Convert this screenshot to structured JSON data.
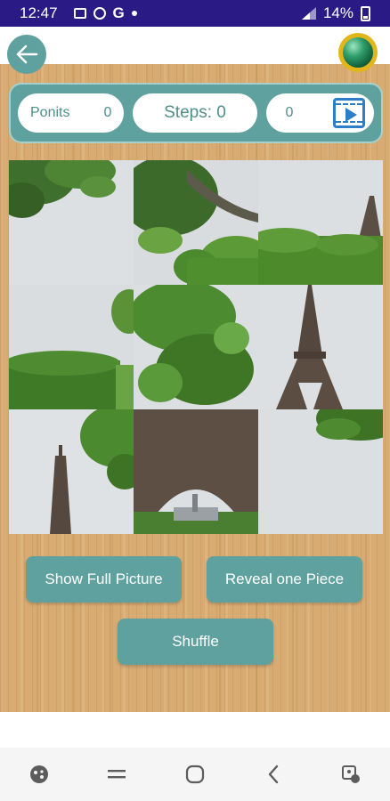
{
  "status": {
    "time": "12:47",
    "notification_icons": [
      "image-icon",
      "whatsapp-icon",
      "google-icon",
      "dot-icon"
    ],
    "google_letter": "G",
    "battery": "14%"
  },
  "header": {
    "back_icon": "arrow-left-icon",
    "coin_icon": "green-orb-icon"
  },
  "scoreboard": {
    "points_label": "Ponits",
    "points_value": "0",
    "steps_label": "Steps: 0",
    "video_count": "0",
    "video_icon": "video-play-icon"
  },
  "puzzle": {
    "rows": 3,
    "cols": 3,
    "tiles": [
      {
        "id": "tile-1",
        "content": "tree top left"
      },
      {
        "id": "tile-2",
        "content": "tree branches"
      },
      {
        "id": "tile-3",
        "content": "tower tip and hedge"
      },
      {
        "id": "tile-4",
        "content": "sky and hedge"
      },
      {
        "id": "tile-5",
        "content": "tree foliage"
      },
      {
        "id": "tile-6",
        "content": "tower upper section"
      },
      {
        "id": "tile-7",
        "content": "tower spire and tree"
      },
      {
        "id": "tile-8",
        "content": "tower arch base"
      },
      {
        "id": "tile-9",
        "content": "sky and tree"
      }
    ]
  },
  "buttons": {
    "show_full_picture": "Show Full Picture",
    "reveal_one_piece": "Reveal one Piece",
    "shuffle": "Shuffle"
  },
  "colors": {
    "accent": "#5fa19e",
    "status_bar": "#2a1a86",
    "wood": "#d8ab73",
    "text_teal": "#4f8f8c"
  }
}
